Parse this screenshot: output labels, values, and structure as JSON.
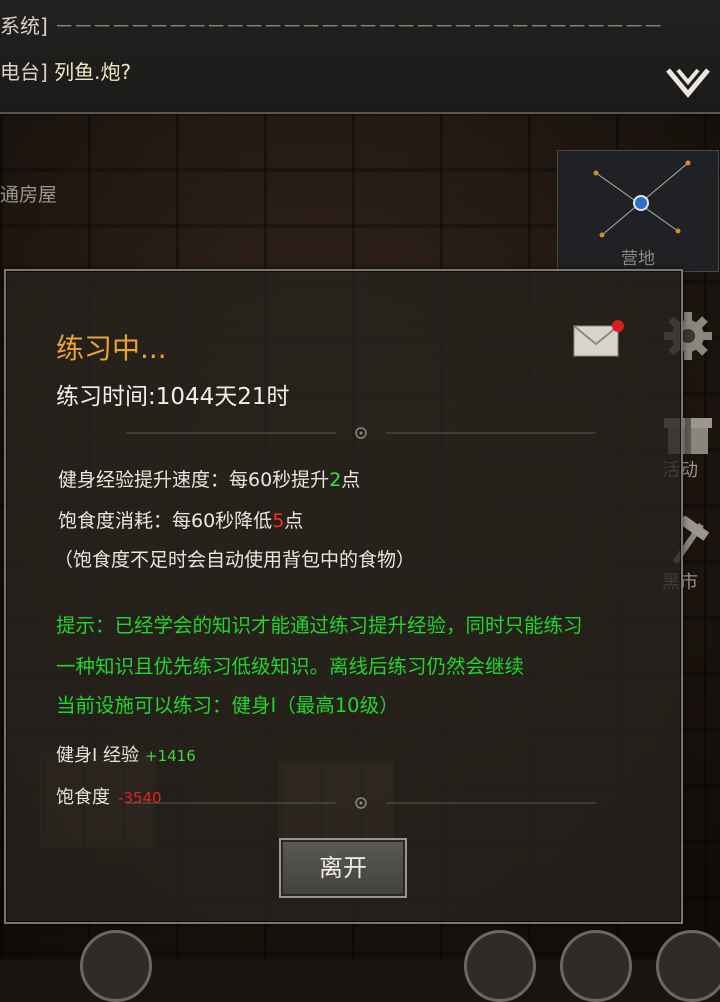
{
  "chat": {
    "line1_tag": "系统]",
    "line2_tag": "电台]",
    "line2_message": "列鱼.炮?"
  },
  "location": {
    "name": "通房屋",
    "minimap_label": "营地"
  },
  "side_menu": {
    "activity_label": "活动",
    "market_label": "黑市"
  },
  "dialog": {
    "title": "练习中...",
    "practice_time": "练习时间:1044天21时",
    "fitness_rate_prefix": "健身经验提升速度：每60秒提升",
    "fitness_rate_value": "2",
    "fitness_rate_suffix": "点",
    "satiety_prefix": "饱食度消耗：每60秒降低",
    "satiety_value": "5",
    "satiety_suffix": "点",
    "satiety_note": "（饱食度不足时会自动使用背包中的食物）",
    "tip_line1": "提示：已经学会的知识才能通过练习提升经验，同时只能练习",
    "tip_line2": "一种知识且优先练习低级知识。离线后练习仍然会继续",
    "tip_line3": "当前设施可以练习：健身Ⅰ（最高10级）",
    "exp_label": "健身Ⅰ 经验",
    "exp_value": "+1416",
    "satiety_stat_label": "饱食度",
    "satiety_stat_value": "-3540",
    "leave_label": "离开"
  },
  "colors": {
    "title_orange": "#e8a530",
    "tip_green": "#21d62a",
    "positive_green": "#3be33b",
    "negative_red": "#ff2b2b"
  },
  "icons": [
    "chevron-down-icon",
    "mail-icon",
    "gear-icon",
    "gift-icon",
    "hammer-icon",
    "map-node-icon"
  ]
}
